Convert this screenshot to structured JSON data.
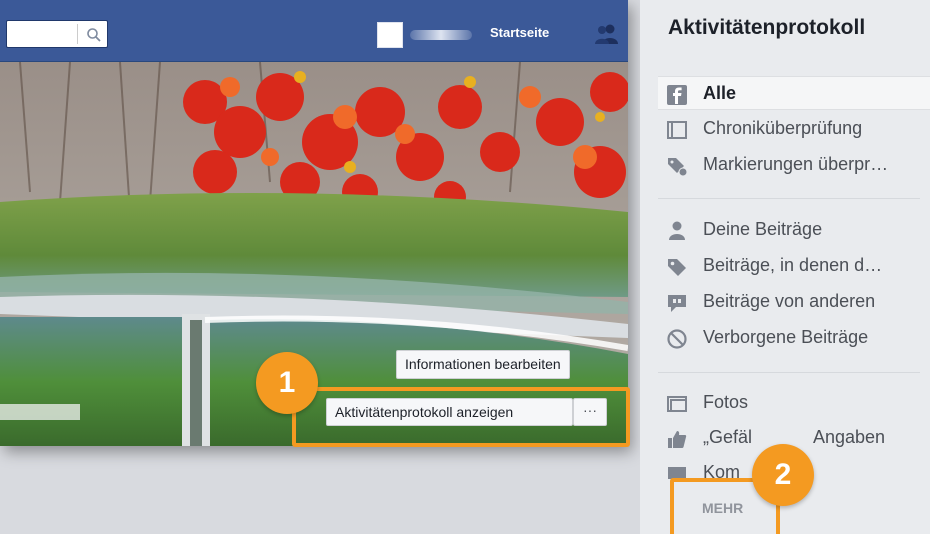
{
  "topbar": {
    "home_label": "Startseite",
    "icons": [
      "search-icon",
      "friends-icon"
    ]
  },
  "cover": {
    "edit_button": "Informationen bearbeiten",
    "activity_button": "Aktivitätenprotokoll anzeigen",
    "more_button": "···"
  },
  "callouts": [
    "1",
    "2"
  ],
  "sidebar": {
    "title": "Aktivitätenprotokoll",
    "items": [
      {
        "label": "Alle",
        "icon": "facebook-icon"
      },
      {
        "label": "Chroniküberprüfung",
        "icon": "timeline-icon"
      },
      {
        "label": "Markierungen überpr…",
        "icon": "tag-review-icon"
      },
      {
        "label": "Deine Beiträge",
        "icon": "person-icon"
      },
      {
        "label": "Beiträge, in denen d…",
        "icon": "tag-icon"
      },
      {
        "label": "Beiträge von anderen",
        "icon": "quote-bubble-icon"
      },
      {
        "label": "Verborgene Beiträge",
        "icon": "hidden-icon"
      },
      {
        "label": "Fotos",
        "icon": "photos-icon"
      },
      {
        "label": "„Gefällt mir“-Angaben",
        "label_visible": "„Gefällt",
        "label_visible_2": "Angaben",
        "icon": "like-icon"
      },
      {
        "label": "Kom",
        "icon": "comment-icon"
      }
    ],
    "more_label": "MEHR"
  },
  "colors": {
    "facebook_blue": "#3b5998",
    "highlight_orange": "#f49a21",
    "sidebar_bg": "#e9ebee"
  }
}
